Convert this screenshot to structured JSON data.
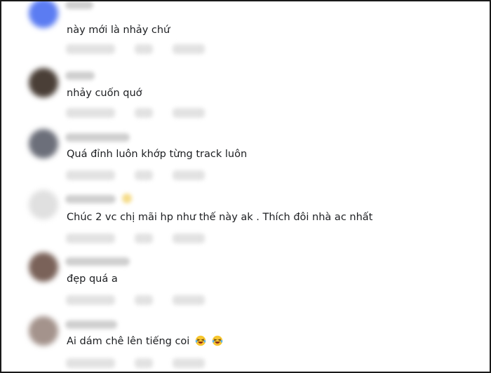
{
  "comments": [
    {
      "text": "này mới là nhảy chứ",
      "avatar_color": "#5b7cf2"
    },
    {
      "text": "nhảy cuốn quớ",
      "avatar_color": "#4a3f37"
    },
    {
      "text": "Quá đỉnh luôn khớp từng track luôn",
      "avatar_color": "#6c6f7a"
    },
    {
      "text": "Chúc 2 vc chị mãi hp như thế này ak . Thích đôi nhà ac nhất",
      "avatar_color": "#e0e0e0"
    },
    {
      "text": "đẹp quá a",
      "avatar_color": "#7a6259"
    },
    {
      "text": "Ai dám chê lên tiếng coi",
      "avatar_color": "#a4938c",
      "emojis": [
        "laughing-crying-emoji",
        "laughing-crying-emoji"
      ]
    }
  ]
}
